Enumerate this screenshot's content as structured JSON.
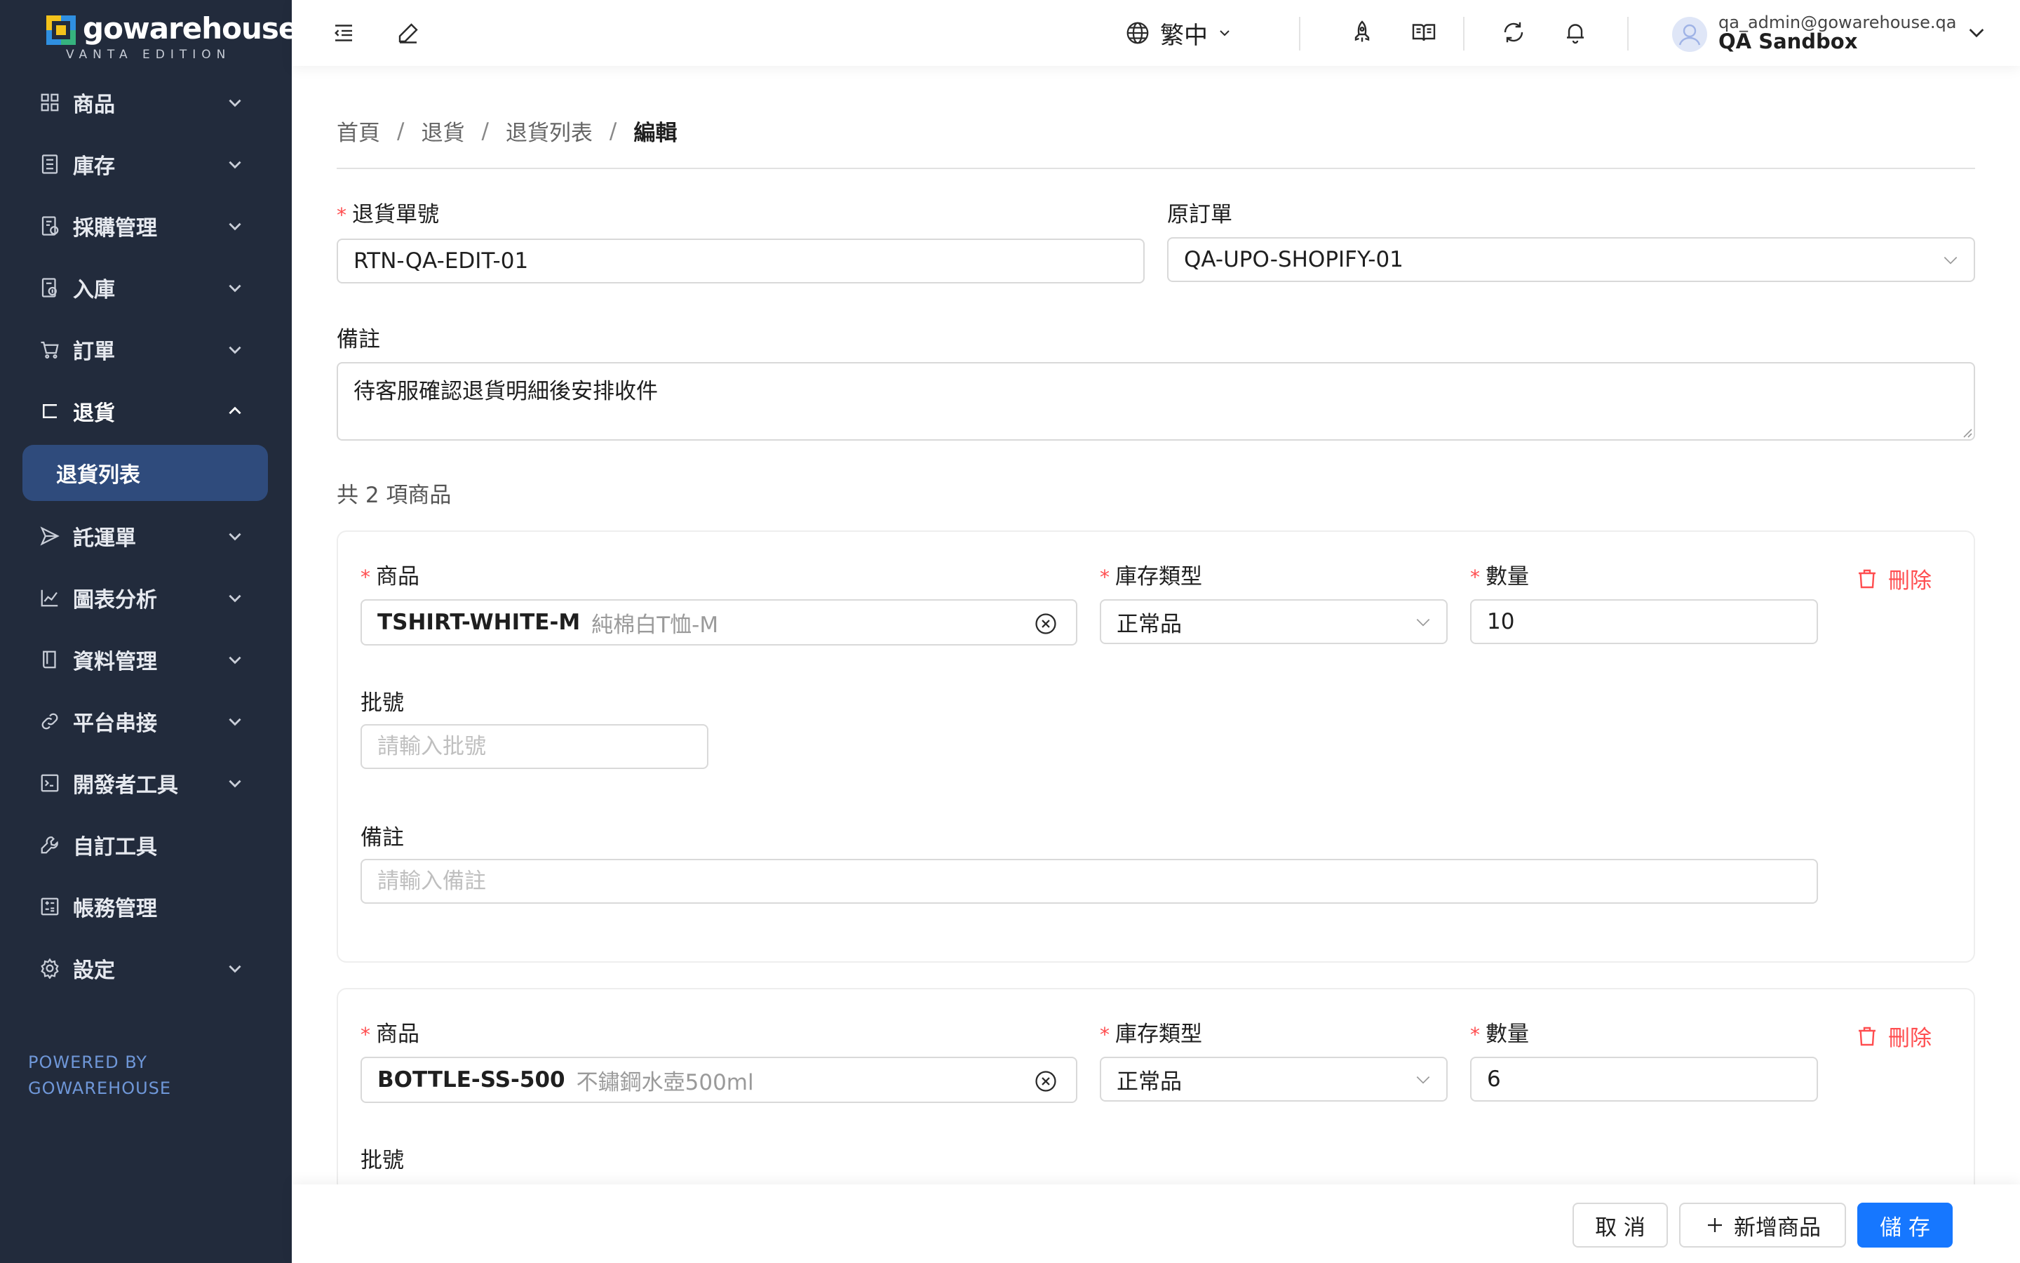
{
  "brand": {
    "name": "gowarehouse",
    "edition": "VANTA EDITION",
    "powered_line1": "POWERED BY",
    "powered_line2": "GOWAREHOUSE"
  },
  "sidebar": {
    "items": [
      {
        "label": "商品",
        "icon": "grid-icon"
      },
      {
        "label": "庫存",
        "icon": "inventory-icon"
      },
      {
        "label": "採購管理",
        "icon": "purchase-icon"
      },
      {
        "label": "入庫",
        "icon": "inbound-icon"
      },
      {
        "label": "訂單",
        "icon": "cart-icon"
      },
      {
        "label": "退貨",
        "icon": "return-icon",
        "expanded": true
      },
      {
        "label": "託運單",
        "icon": "send-icon"
      },
      {
        "label": "圖表分析",
        "icon": "chart-icon"
      },
      {
        "label": "資料管理",
        "icon": "book-icon"
      },
      {
        "label": "平台串接",
        "icon": "link-icon"
      },
      {
        "label": "開發者工具",
        "icon": "terminal-icon"
      },
      {
        "label": "自訂工具",
        "icon": "wrench-icon"
      },
      {
        "label": "帳務管理",
        "icon": "calculator-icon"
      },
      {
        "label": "設定",
        "icon": "gear-icon"
      }
    ],
    "active_sub": "退貨列表"
  },
  "header": {
    "language": "繁中",
    "user_email": "qa_admin@gowarehouse.qa",
    "user_org": "QA Sandbox"
  },
  "breadcrumb": {
    "home": "首頁",
    "returns": "退貨",
    "list": "退貨列表",
    "current": "編輯",
    "separator": "/"
  },
  "form": {
    "return_no_label": "退貨單號",
    "return_no_value": "RTN-QA-EDIT-01",
    "original_order_label": "原訂單",
    "original_order_value": "QA-UPO-SHOPIFY-01",
    "note_label": "備註",
    "note_value": "待客服確認退貨明細後安排收件",
    "items_count": "共 2 項商品"
  },
  "items": [
    {
      "product_label": "商品",
      "product_sku": "TSHIRT-WHITE-M",
      "product_name": "純棉白T恤-M",
      "stock_type_label": "庫存類型",
      "stock_type_value": "正常品",
      "qty_label": "數量",
      "qty_value": "10",
      "delete_label": "刪除",
      "batch_label": "批號",
      "batch_placeholder": "請輸入批號",
      "note_label": "備註",
      "note_placeholder": "請輸入備註"
    },
    {
      "product_label": "商品",
      "product_sku": "BOTTLE-SS-500",
      "product_name": "不鏽鋼水壺500ml",
      "stock_type_label": "庫存類型",
      "stock_type_value": "正常品",
      "qty_label": "數量",
      "qty_value": "6",
      "delete_label": "刪除",
      "batch_label": "批號"
    }
  ],
  "footer": {
    "cancel": "取 消",
    "add_product": "新增商品",
    "save": "儲 存"
  },
  "colors": {
    "sidebar_bg": "#222b3c",
    "sidebar_active": "#2f4b7c",
    "primary": "#1677ff",
    "danger": "#ff4d4f",
    "required": "#ff4d4f"
  }
}
